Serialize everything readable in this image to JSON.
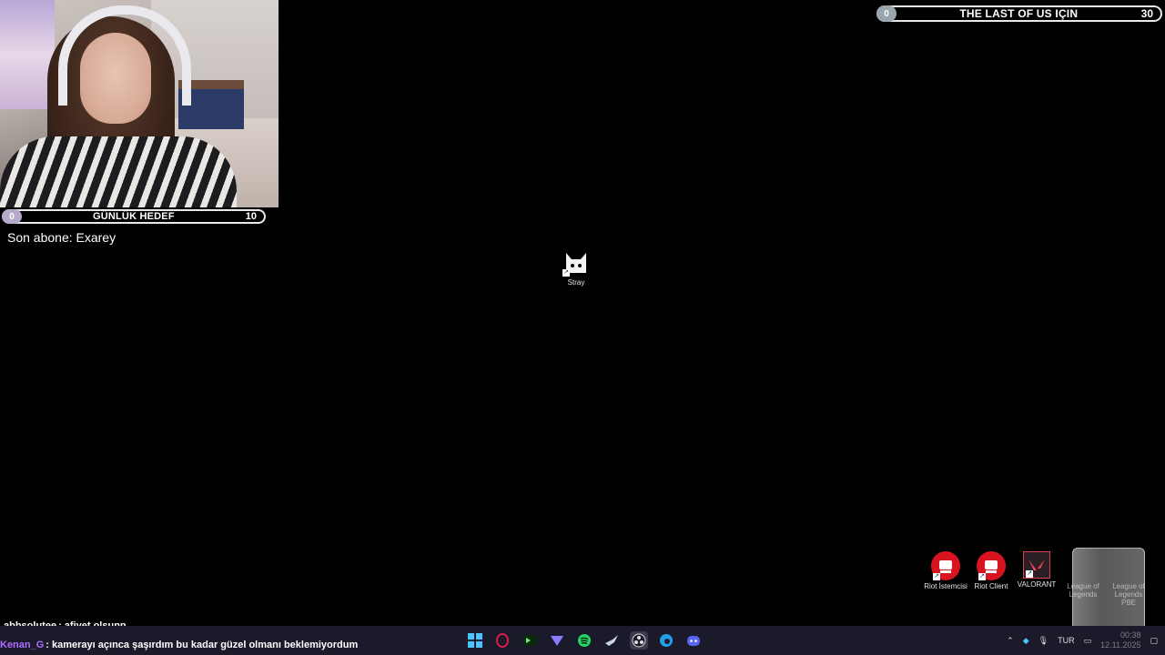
{
  "overlay": {
    "daily_goal": {
      "current": "0",
      "title": "GÜNLÜK HEDEF",
      "target": "10"
    },
    "game_goal": {
      "current": "0",
      "title": "THE LAST OF US IÇIN",
      "target": "30"
    },
    "last_subscriber": "Son abone: Exarey"
  },
  "desktop": {
    "icons": [
      {
        "label": "Stray"
      },
      {
        "label": "Riot İstemcisi"
      },
      {
        "label": "Riot Client"
      },
      {
        "label": "VALORANT"
      },
      {
        "label": "League of Legends"
      },
      {
        "label": "League of Legends PBE"
      }
    ]
  },
  "chat": [
    {
      "user": "abbsolutee",
      "message": ": afiyet olsunn",
      "color": "#ffffff"
    },
    {
      "user": "Kenan_G",
      "message": ": kamerayı açınca şaşırdım bu kadar güzel olmanı beklemiyordum",
      "color": "#b06bff"
    }
  ],
  "taskbar": {
    "apps": [
      "windows-start-icon",
      "opera-gx-icon",
      "terminal-icon",
      "vpn-icon",
      "spotify-icon",
      "steam-icon",
      "obs-icon",
      "edge-icon",
      "discord-icon"
    ],
    "tray": {
      "language": "TUR",
      "time": "00:38",
      "date": "12.11.2025"
    }
  }
}
